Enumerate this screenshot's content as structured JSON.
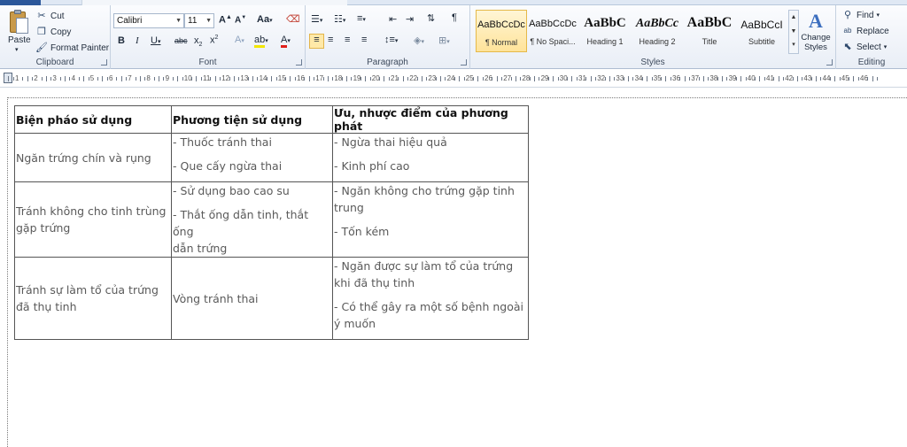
{
  "ribbon": {
    "clipboard": {
      "label": "Clipboard",
      "paste": "Paste",
      "cut": "Cut",
      "copy": "Copy",
      "format_painter": "Format Painter"
    },
    "font": {
      "label": "Font",
      "font_name": "Calibri",
      "font_size": "11"
    },
    "paragraph": {
      "label": "Paragraph"
    },
    "styles": {
      "label": "Styles",
      "items": [
        {
          "sample": "AaBbCcDc",
          "name": "¶ Normal"
        },
        {
          "sample": "AaBbCcDc",
          "name": "¶ No Spaci..."
        },
        {
          "sample": "AaBbC",
          "name": "Heading 1"
        },
        {
          "sample": "AaBbCc",
          "name": "Heading 2"
        },
        {
          "sample": "AaBbC",
          "name": "Title"
        },
        {
          "sample": "AaBbCcI",
          "name": "Subtitle"
        }
      ],
      "change_styles": "Change Styles"
    },
    "editing": {
      "label": "Editing",
      "find": "Find",
      "replace": "Replace",
      "select": "Select"
    }
  },
  "ruler": {
    "numbers": [
      "1",
      "2",
      "3",
      "4",
      "5",
      "6",
      "7",
      "8",
      "9",
      "10",
      "11",
      "12",
      "13",
      "14",
      "15",
      "16",
      "17",
      "18",
      "19",
      "20",
      "21",
      "22",
      "23",
      "24",
      "25",
      "26",
      "27",
      "28",
      "29",
      "30",
      "31",
      "32",
      "33",
      "34",
      "35",
      "36",
      "37",
      "38",
      "39",
      "40",
      "41",
      "42",
      "43",
      "44",
      "45",
      "46"
    ]
  },
  "table": {
    "headers": [
      "Biện pháo sử dụng",
      "Phương tiện sử dụng",
      "Ưu, nhược điểm của phương phát"
    ],
    "rows": [
      {
        "c1": "Ngăn trứng chín và rụng",
        "c2": [
          "- Thuốc tránh thai",
          "- Que cấy ngừa thai"
        ],
        "c3": [
          "- Ngừa thai hiệu quả",
          "- Kinh phí cao"
        ]
      },
      {
        "c1a": "Tránh không cho tinh trùng",
        "c1b": "gặp trứng",
        "c2a": "- Sử dụng bao cao su",
        "c2b": "- Thắt ống dẫn tinh, thắt ống",
        "c2c": "dẫn trứng",
        "c3a": "- Ngăn không cho trứng gặp tinh",
        "c3b": "trung",
        "c3c": "- Tốn kém"
      },
      {
        "c1a": "Tránh sự làm tổ của trứng",
        "c1b": "đã thụ tinh",
        "c2": "Vòng tránh thai",
        "c3a": "- Ngăn được sự làm tổ của trứng",
        "c3b": "khi đã thụ tinh",
        "c3c": "- Có thể gây ra một số bệnh ngoài",
        "c3d": "ý muốn"
      }
    ]
  }
}
